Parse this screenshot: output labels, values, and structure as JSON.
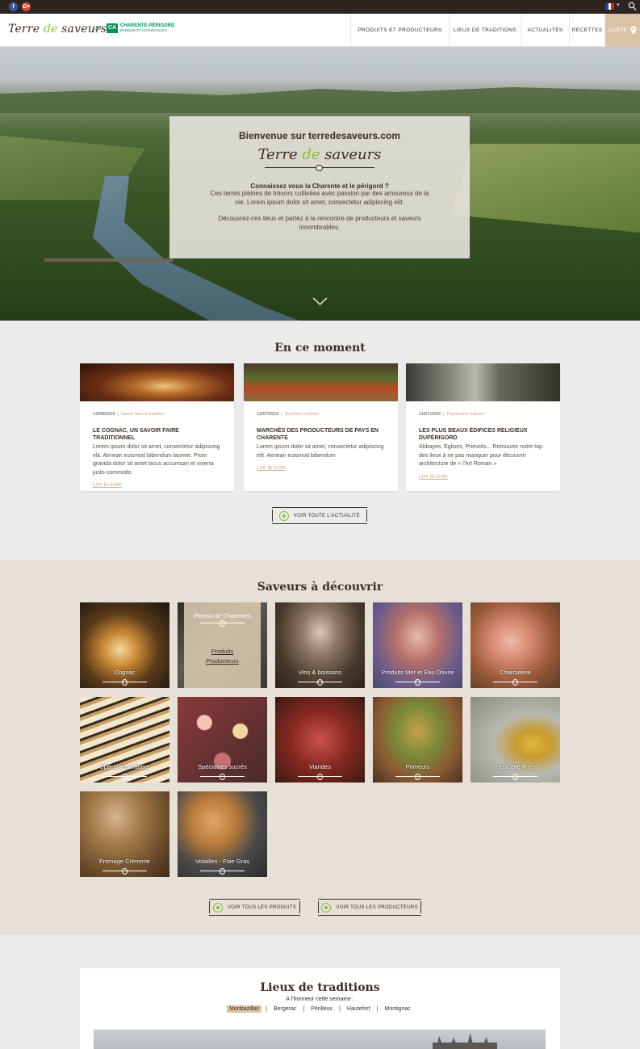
{
  "social": {
    "facebook": "f",
    "google": "G+"
  },
  "header": {
    "logo": {
      "part1": "Terre ",
      "part2": "de",
      "part3": " saveurs"
    },
    "by": "par",
    "partner_mark": "CA",
    "partner_name": "CHARENTE-PÉRIGORD",
    "partner_tagline": "BANQUE ET ASSURANCES",
    "nav": [
      "PRODUITS ET PRODUCTEURS",
      "LIEUX DE TRADITIONS",
      "ACTUALITÉS",
      "RECETTES"
    ],
    "carte": "CARTE"
  },
  "hero": {
    "welcome": "Bienvenue sur terredesaveurs.com",
    "logo": {
      "part1": "Terre ",
      "part2": "de",
      "part3": " saveurs"
    },
    "question": "Connaissez vous la Charente et le périgord ?",
    "text1": "Ces terres pleines de trésors cultivées avec passion par des amoureux de la vie. Lorem ipsum dolor sit amet, consectetur adipiscing elit.",
    "text2": "Découvrez-ces lieux et partez à la rencontre de producteurs et saveurs innombrables."
  },
  "news_section": {
    "title": "En ce moment",
    "items": [
      {
        "date": "13/08/2016",
        "category": "Savoir faire & tradition",
        "title": "LE COGNAC, UN SAVOIR FAIRE TRADITIONNEL",
        "text": "Lorem ipsum dolor sit amet, consectetur adipiscing elit. Aenean euismod bibendum laoreet. Proin gravida dolor sit amet lacus accumsan et viverra justo commodo.",
        "link": "Lire la suite"
      },
      {
        "date": "13/07/2016",
        "category": "Marchés et foires",
        "title": "MARCHÉS DES PRODUCTEURS DE PAYS EN CHARENTE",
        "text": "Lorem ipsum dolor sit amet, consectetur adipiscing elit. Aenean euismod bibendum",
        "link": "Lire la suite"
      },
      {
        "date": "11/07/2016",
        "category": "Patrimoine culturel",
        "title": "LES PLUS BEAUX ÉDIFICES RELIGIEUX DUPÉRIGORD",
        "text": "Abbayes, Eglises, Prieurés... Retrouvez notre top des lieux à ne pas manquer pour découvrir architecture de « l'Art Roman »",
        "link": "Lire la suite"
      }
    ],
    "button": "VOIR TOUTE L'ACTUALITÉ"
  },
  "saveurs_section": {
    "title": "Saveurs à découvrir",
    "tiles": [
      {
        "label": "Cognac"
      },
      {
        "label": "Pineau de Charentes",
        "hover_links": [
          "Produits",
          "Producteurs"
        ]
      },
      {
        "label": "Vins & boissons"
      },
      {
        "label": "Produits Mer et Eau Douce"
      },
      {
        "label": "Charcuterie"
      },
      {
        "label": "Spécialités traiteur"
      },
      {
        "label": "Spécialités sucrés"
      },
      {
        "label": "Viandes"
      },
      {
        "label": "Primeurs"
      },
      {
        "label": "Epicerie fine"
      },
      {
        "label": "Fromage Crèmerie"
      },
      {
        "label": "Volailles - Foie Gras"
      }
    ],
    "button_products": "VOIR TOUS LES PRODUITS",
    "button_producers": "VOIR TOUS LES PRODUCTEURS"
  },
  "lieux_section": {
    "title": "Lieux de traditions",
    "subtitle": "A l'honneur cette semaine :",
    "tabs": [
      "Monbazillac",
      "Bergerac",
      "Périlleux",
      "Hautefort",
      "Montignac"
    ],
    "active_tab": "Monbazillac"
  },
  "colors": {
    "accent_green": "#8dbb42",
    "accent_tan": "#d9c3a6",
    "dark_brown": "#3b2f25",
    "topbar": "#2e2521"
  },
  "icons": [
    "facebook-icon",
    "google-plus-icon",
    "french-flag-icon",
    "search-icon",
    "map-pin-icon",
    "chevron-down-icon",
    "eye-icon"
  ]
}
